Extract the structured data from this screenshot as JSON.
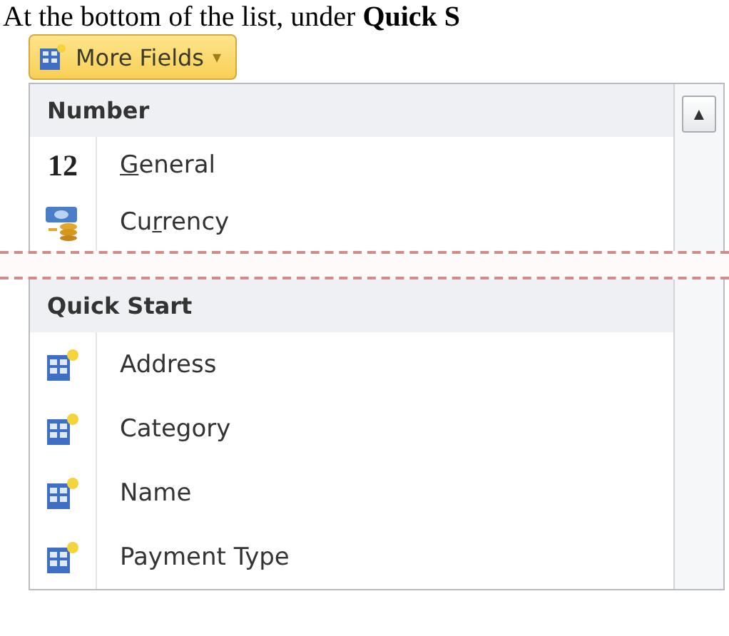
{
  "caption": "At the bottom of the list, under **Quick S**",
  "button": {
    "label": "More Fields",
    "caret": "▾"
  },
  "sections": [
    {
      "title": "Number",
      "scroll_up": "▲",
      "items": [
        {
          "kind": "number",
          "glyph": "12",
          "key": "G",
          "post": "eneral"
        },
        {
          "kind": "currency",
          "pre": "Cu",
          "key": "r",
          "post": "rency"
        }
      ]
    },
    {
      "title": "Quick Start",
      "items": [
        {
          "kind": "table",
          "pre": "Address"
        },
        {
          "kind": "table",
          "pre": "Category"
        },
        {
          "kind": "table",
          "pre": "Name"
        },
        {
          "kind": "table",
          "pre": "Payment Type"
        }
      ]
    }
  ]
}
